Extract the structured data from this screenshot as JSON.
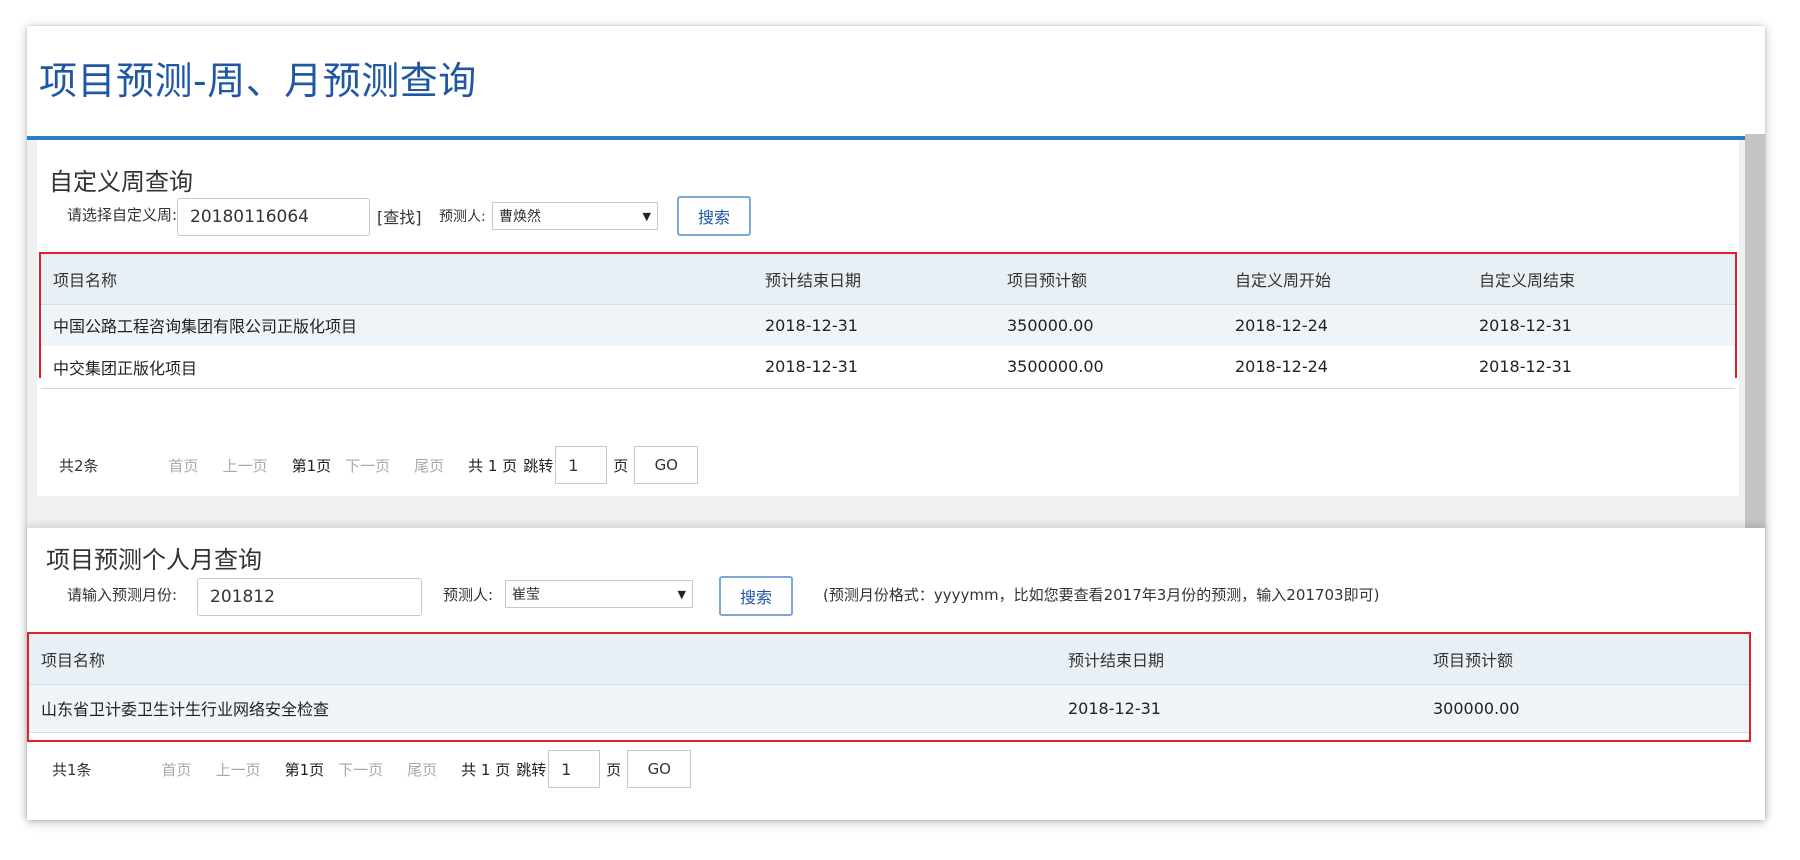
{
  "page_title": "项目预测-周、月预测查询",
  "week_section": {
    "title": "自定义周查询",
    "week_label": "请选择自定义周:",
    "week_value": "20180116064",
    "find_label": "[查找]",
    "forecaster_label": "预测人:",
    "forecaster_value": "曹焕然",
    "search_label": "搜索",
    "table": {
      "headers": [
        "项目名称",
        "预计结束日期",
        "项目预计额",
        "自定义周开始",
        "自定义周结束"
      ],
      "rows": [
        [
          "中国公路工程咨询集团有限公司正版化项目",
          "2018-12-31",
          "350000.00",
          "2018-12-24",
          "2018-12-31"
        ],
        [
          "中交集团正版化项目",
          "2018-12-31",
          "3500000.00",
          "2018-12-24",
          "2018-12-31"
        ]
      ]
    },
    "pager": {
      "total": "共2条",
      "first": "首页",
      "prev": "上一页",
      "current": "第1页",
      "next": "下一页",
      "last": "尾页",
      "pages": "共 1 页",
      "jump": "跳转",
      "page_value": "1",
      "unit": "页",
      "go": "GO"
    }
  },
  "month_section": {
    "title": "项目预测个人月查询",
    "month_label": "请输入预测月份:",
    "month_value": "201812",
    "forecaster_label": "预测人:",
    "forecaster_value": "崔莹",
    "search_label": "搜索",
    "hint": "(预测月份格式：yyyymm，比如您要查看2017年3月份的预测，输入201703即可)",
    "table": {
      "headers": [
        "项目名称",
        "预计结束日期",
        "项目预计额"
      ],
      "rows": [
        [
          "山东省卫计委卫生计生行业网络安全检查",
          "2018-12-31",
          "300000.00"
        ]
      ]
    },
    "pager": {
      "total": "共1条",
      "first": "首页",
      "prev": "上一页",
      "current": "第1页",
      "next": "下一页",
      "last": "尾页",
      "pages": "共 1 页",
      "jump": "跳转",
      "page_value": "1",
      "unit": "页",
      "go": "GO"
    }
  }
}
